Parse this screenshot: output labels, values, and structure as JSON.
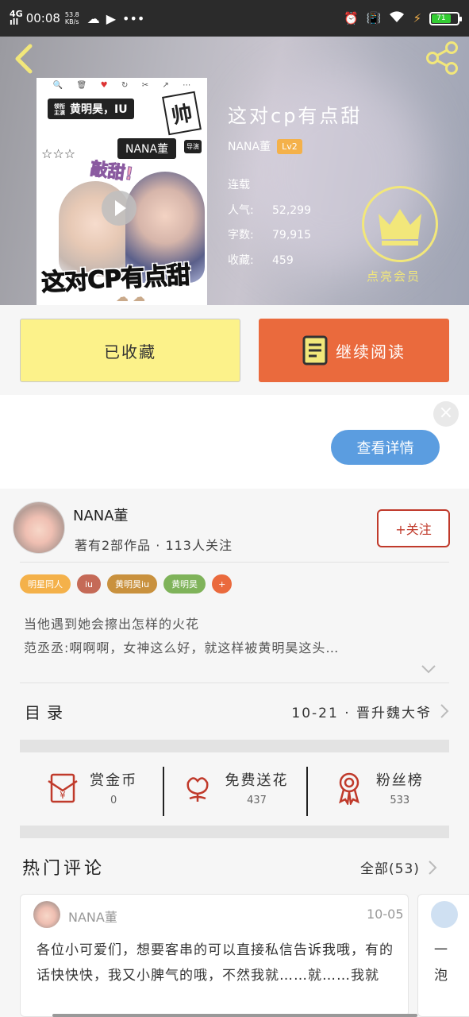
{
  "status_bar": {
    "network": "4G",
    "signal": "ıll",
    "time": "00:08",
    "speed_value": "53.8",
    "speed_unit": "KB/s",
    "battery": "71"
  },
  "header": {
    "book_title": "这对cp有点甜",
    "author": "NANA董",
    "level": "Lv2",
    "status": "连载",
    "stats": [
      {
        "label": "人气:",
        "value": "52,299"
      },
      {
        "label": "字数:",
        "value": "79,915"
      },
      {
        "label": "收藏:",
        "value": "459"
      }
    ],
    "vip_label": "点亮会员"
  },
  "cover": {
    "tag_small": "领衔主演",
    "tag_names": "黄明昊，IU",
    "shuai": "帅",
    "tag_author": "NANA董",
    "tag_author_sub": "导演",
    "sweet": "敲甜!",
    "stars": "☆☆☆",
    "big_title": "这对CP有点甜",
    "clouds": "☁ ☁"
  },
  "actions": {
    "collected_label": "已收藏",
    "read_label": "继续阅读"
  },
  "ad": {
    "close_label": "×",
    "detail_label": "查看详情"
  },
  "author_info": {
    "name": "NANA董",
    "meta": "著有2部作品 · 113人关注",
    "follow_label": "+关注"
  },
  "tags": [
    {
      "label": "明星同人",
      "color": "#f4b14a"
    },
    {
      "label": "iu",
      "color": "#c56a57"
    },
    {
      "label": "黄明昊iu",
      "color": "#c9913e"
    },
    {
      "label": "黄明昊",
      "color": "#7fb35a"
    },
    {
      "label": "+",
      "color": "#ea6a3d"
    }
  ],
  "synopsis": {
    "line1": "当他遇到她会擦出怎样的火花",
    "line2": "范丞丞:啊啊啊，女神这么好，就这样被黄明昊这头…"
  },
  "toc": {
    "label": "目录",
    "latest": "10-21 · 晋升魏大爷"
  },
  "rewards": [
    {
      "label": "赏金币",
      "value": "0",
      "icon": "red-envelope-icon"
    },
    {
      "label": "免费送花",
      "value": "437",
      "icon": "flower-icon"
    },
    {
      "label": "粉丝榜",
      "value": "533",
      "icon": "medal-icon"
    }
  ],
  "comments": {
    "title": "热门评论",
    "all_label": "全部(53)",
    "items": [
      {
        "user": "NANA董",
        "date": "10-05",
        "text": "各位小可爱们，想要客串的可以直接私信告诉我哦，有的话快快快，我又小脾气的哦，不然我就……就……我就"
      }
    ],
    "peek_text": "一\n泡"
  },
  "colors": {
    "accent_orange": "#ea6a3d",
    "collected_yellow": "#fcf28a",
    "follow_red": "#c03a2b",
    "detail_blue": "#5b9de0",
    "vip_yellow": "#f2e77a"
  }
}
